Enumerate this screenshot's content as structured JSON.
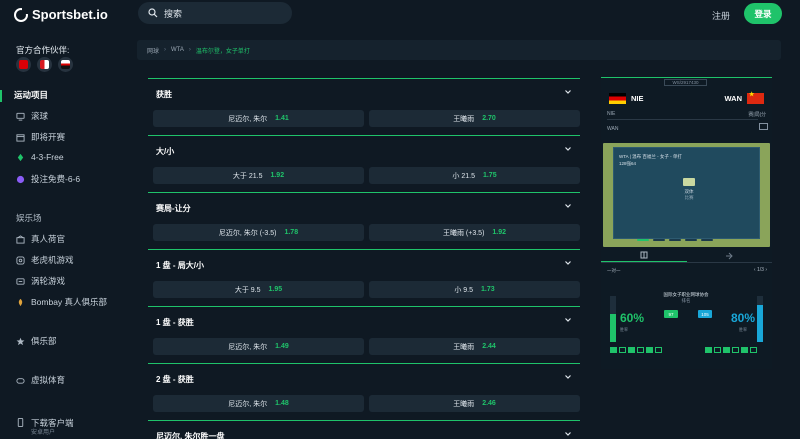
{
  "brand": {
    "name": "Sportsbet.io"
  },
  "search": {
    "placeholder": "搜索"
  },
  "header": {
    "register": "注册",
    "login": "登录"
  },
  "sidebar": {
    "partners_title": "官方合作伙伴:",
    "partners": [
      {
        "icon": "arsenal-badge-icon",
        "color": "#db0007"
      },
      {
        "icon": "southampton-badge-icon",
        "color": "#d71920"
      },
      {
        "icon": "sao-paulo-badge-icon",
        "color": "#e8e8e8"
      }
    ],
    "sports_title": "运动项目",
    "sports_items": [
      {
        "label": "滚球",
        "icon": "monitor-icon"
      },
      {
        "label": "即将开赛",
        "icon": "calendar-icon"
      },
      {
        "label": "4-3-Free",
        "icon": "gift-icon"
      },
      {
        "label": "投注免费-6-6",
        "icon": "coin-icon"
      }
    ],
    "casino_title": "娱乐场",
    "casino_items": [
      {
        "label": "真人荷官",
        "icon": "dealer-icon"
      },
      {
        "label": "老虎机游戏",
        "icon": "slots-icon"
      },
      {
        "label": "涡轮游戏",
        "icon": "turbo-icon"
      },
      {
        "label": "Bombay 真人俱乐部",
        "icon": "bombay-icon"
      }
    ],
    "club": {
      "label": "俱乐部",
      "icon": "star-icon"
    },
    "virtual": {
      "label": "虚拟体育",
      "icon": "gamepad-icon"
    },
    "download": {
      "label": "下载客户端",
      "sub": "安卓用户"
    }
  },
  "breadcrumb": [
    "网球",
    "WTA",
    "温布尔登，女子单打"
  ],
  "markets": [
    {
      "title": "获胜",
      "odds": [
        {
          "label": "尼迈尔, 朱尔",
          "price": "1.41"
        },
        {
          "label": "王曦雨",
          "price": "2.70"
        }
      ]
    },
    {
      "title": "大/小",
      "odds": [
        {
          "label": "大于 21.5",
          "price": "1.92"
        },
        {
          "label": "小 21.5",
          "price": "1.75"
        }
      ]
    },
    {
      "title": "赛局-让分",
      "odds": [
        {
          "label": "尼迈尔, 朱尔 (-3.5)",
          "price": "1.78"
        },
        {
          "label": "王曦雨 (+3.5)",
          "price": "1.92"
        }
      ]
    },
    {
      "title": "1 盘 - 局大/小",
      "odds": [
        {
          "label": "大于 9.5",
          "price": "1.95"
        },
        {
          "label": "小 9.5",
          "price": "1.73"
        }
      ]
    },
    {
      "title": "1 盘 - 获胜",
      "odds": [
        {
          "label": "尼迈尔, 朱尔",
          "price": "1.49"
        },
        {
          "label": "王曦雨",
          "price": "2.44"
        }
      ]
    },
    {
      "title": "2 盘 - 获胜",
      "odds": [
        {
          "label": "尼迈尔, 朱尔",
          "price": "1.48"
        },
        {
          "label": "王曦雨",
          "price": "2.46"
        }
      ]
    },
    {
      "title": "尼迈尔, 朱尔胜一盘",
      "odds": []
    }
  ],
  "widget": {
    "tag": "WS/2917430",
    "home": {
      "code": "NIE",
      "flag": "germany-flag-icon"
    },
    "away": {
      "code": "WAN",
      "flag": "china-flag-icon"
    },
    "score_home": "NIE",
    "score_right": "赛|局|分",
    "score_away": "WAN",
    "court_line1": "WTA | 温布 百福兰 - 女子 - 单打",
    "court_line2": "128强64",
    "court_status": "双体",
    "court_sub": "比赛",
    "pager_left": "一对一",
    "pager_right": "1/3",
    "stat_title_1": "国际女子职业网球协会",
    "stat_title_2": "排名",
    "home_rank": "97",
    "away_rank": "105",
    "home_pct": "60%",
    "away_pct": "80%",
    "home_pct_label": "胜率",
    "away_pct_label": "胜率",
    "home_fill": 0.6,
    "away_fill": 0.8,
    "home_color": "#1fc36a",
    "away_color": "#19a7d8"
  }
}
